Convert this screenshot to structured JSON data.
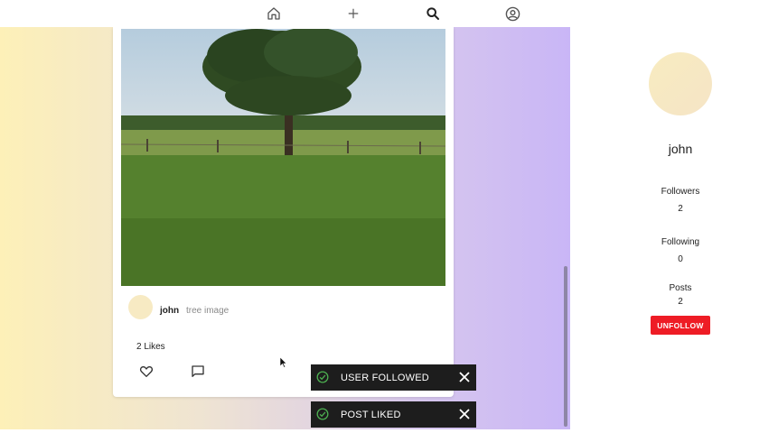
{
  "nav": {
    "icons": [
      "home-icon",
      "plus-icon",
      "search-icon",
      "account-icon"
    ]
  },
  "post": {
    "author": "john",
    "caption": "tree image",
    "likes": "2 Likes",
    "image": "tree in a grassy field"
  },
  "toasts": [
    {
      "message": "USER FOLLOWED",
      "icon": "check-circle-icon"
    },
    {
      "message": "POST LIKED",
      "icon": "check-circle-icon"
    }
  ],
  "profile": {
    "name": "john",
    "followers_label": "Followers",
    "followers_count": "2",
    "following_label": "Following",
    "following_count": "0",
    "posts_label": "Posts",
    "posts_count": "2",
    "unfollow_label": "UNFOLLOW"
  },
  "colors": {
    "accent_red": "#ee1c25",
    "toast_bg": "#1d1d1d",
    "toast_check": "#4caf50",
    "avatar": "#f7eac3",
    "gradient_start": "#fdf0b8",
    "gradient_end": "#c9b6f6"
  }
}
